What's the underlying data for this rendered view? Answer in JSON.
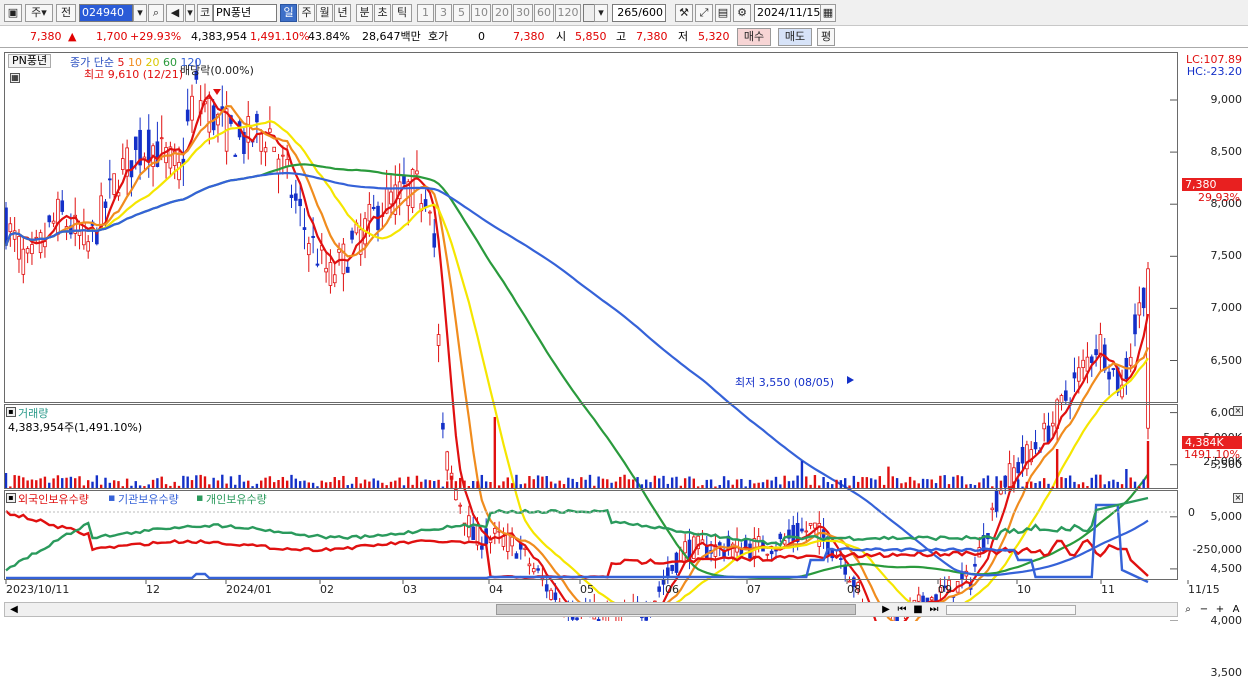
{
  "toolbar": {
    "tab1": "주",
    "tab2": "전",
    "code": "024940",
    "search_icon": "search-icon",
    "speaker_icon": "speaker-icon",
    "market": "코",
    "name": "PN풍년",
    "periods": [
      "일",
      "주",
      "월",
      "년",
      "분",
      "초",
      "틱"
    ],
    "active_period": "일",
    "intervals": [
      "1",
      "3",
      "5",
      "10",
      "20",
      "30",
      "60",
      "120"
    ],
    "count": "265",
    "count_total": "/600",
    "date": "2024/11/15"
  },
  "quote": {
    "price": "7,380",
    "change": "1,700",
    "change_pct": "+29.93%",
    "volume": "4,383,954",
    "vol_ratio": "1,491.10%",
    "turnover": "43.84%",
    "amount": "28,647백만",
    "hoga_label": "호가",
    "hoga": "0",
    "bid_price": "7,380",
    "open_label": "시",
    "open": "5,850",
    "high_label": "고",
    "high": "7,380",
    "low_label": "저",
    "low": "5,320",
    "buy": "매수",
    "sell": "매도",
    "avg": "평"
  },
  "chart": {
    "ticker_tab": "PN풍년",
    "ma_label": "종가 단순",
    "ma_periods": [
      "5",
      "10",
      "20",
      "60",
      "120"
    ],
    "ma_colors": [
      "#e01010",
      "#f08c1e",
      "#f5e600",
      "#2a9a3c",
      "#3562d8"
    ],
    "high_note": "최고 9,610 (12/21)",
    "dividend_note": "배당락(0.00%)",
    "low_note": "최저 3,550 (08/05)",
    "lc": "LC:107.89",
    "hc": "HC:-23.20",
    "price_tag": "7,380",
    "pct_tag": "29.93%",
    "y_ticks": [
      "9,000",
      "8,500",
      "8,000",
      "7,500",
      "7,000",
      "6,500",
      "6,000",
      "5,500",
      "5,000",
      "4,500",
      "4,000",
      "3,500"
    ],
    "up_color": "#e01010",
    "down_color": "#1430c8"
  },
  "volume": {
    "title": "거래량",
    "value": "4,383,954주(1,491.10%)",
    "y_ticks": [
      "5,000K",
      "2,500K"
    ],
    "tag": "4,384K",
    "tag2": "1491.10%"
  },
  "holdings": {
    "series": [
      "외국인보유수량",
      "기관보유수량",
      "개인보유수량"
    ],
    "colors": [
      "#e01010",
      "#3562d8",
      "#2a9a5c"
    ],
    "y_ticks": [
      "0",
      "-250,000"
    ]
  },
  "x_labels": [
    "2023/10/11",
    "12",
    "2024/01",
    "02",
    "03",
    "04",
    "05",
    "06",
    "07",
    "08",
    "09",
    "10",
    "11",
    "11/15"
  ],
  "chart_data": {
    "type": "candlestick",
    "title": "PN풍년",
    "ylim": [
      3300,
      9700
    ],
    "approx_close_by_month": [
      {
        "x": "2023/10",
        "close": 7600
      },
      {
        "x": "2023/11",
        "close": 8000
      },
      {
        "x": "2023/12",
        "close": 8900
      },
      {
        "x": "2024/01",
        "close": 8600
      },
      {
        "x": "2024/02",
        "close": 7800
      },
      {
        "x": "2024/03",
        "close": 4800
      },
      {
        "x": "2024/04",
        "close": 4100
      },
      {
        "x": "2024/05",
        "close": 4100
      },
      {
        "x": "2024/06",
        "close": 4800
      },
      {
        "x": "2024/07",
        "close": 4700
      },
      {
        "x": "2024/08",
        "close": 3900
      },
      {
        "x": "2024/09",
        "close": 4400
      },
      {
        "x": "2024/10",
        "close": 5800
      },
      {
        "x": "2024/11",
        "close": 7380
      }
    ],
    "last": {
      "open": 5850,
      "high": 7380,
      "low": 5320,
      "close": 7380,
      "volume": 4383954
    }
  }
}
